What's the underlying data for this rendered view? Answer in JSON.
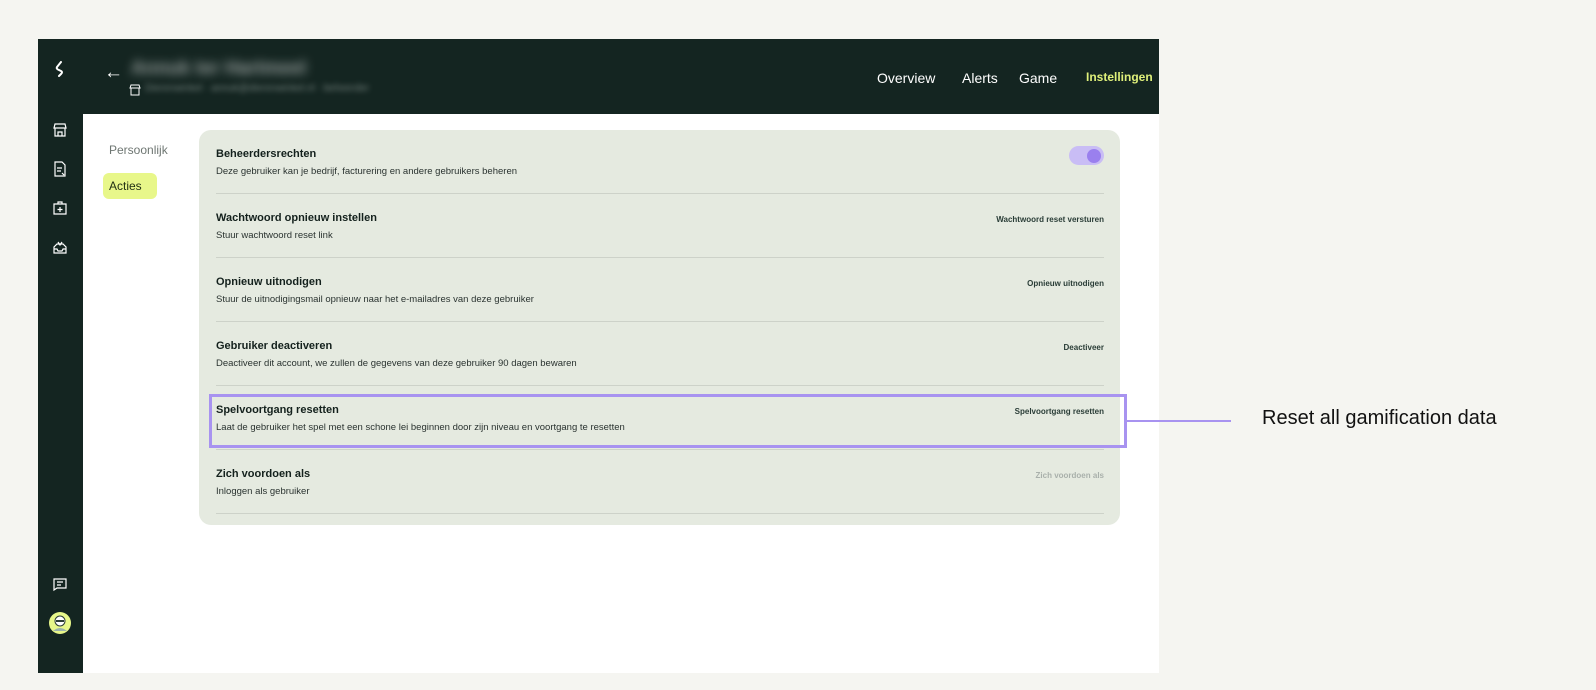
{
  "header": {
    "title_blurred": "Annuk ter Hartmeel",
    "subtitle_blurred": "Dierenwinkel · annuk@dierenwinkel.nl · beheerder",
    "tabs": [
      {
        "label": "Overview",
        "active": false
      },
      {
        "label": "Alerts",
        "active": false
      },
      {
        "label": "Game",
        "active": false
      },
      {
        "label": "Instellingen",
        "active": true
      }
    ]
  },
  "sidebar": {
    "icons": [
      "logo-icon",
      "store-icon",
      "document-icon",
      "medical-case-icon",
      "inbox-icon",
      "chat-icon",
      "avatar"
    ]
  },
  "subnav": {
    "items": [
      {
        "label": "Persoonlijk",
        "active": false
      },
      {
        "label": "Acties",
        "active": true
      }
    ]
  },
  "settings": {
    "rows": [
      {
        "title": "Beheerdersrechten",
        "description": "Deze gebruiker kan je bedrijf, facturering en andere gebruikers beheren",
        "control": "toggle",
        "toggle_on": true
      },
      {
        "title": "Wachtwoord opnieuw instellen",
        "description": "Stuur wachtwoord reset link",
        "action": "Wachtwoord reset versturen"
      },
      {
        "title": "Opnieuw uitnodigen",
        "description": "Stuur de uitnodigingsmail opnieuw naar het e-mailadres van deze gebruiker",
        "action": "Opnieuw uitnodigen"
      },
      {
        "title": "Gebruiker deactiveren",
        "description": "Deactiveer dit account, we zullen de gegevens van deze gebruiker 90 dagen bewaren",
        "action": "Deactiveer"
      },
      {
        "title": "Spelvoortgang resetten",
        "description": "Laat de gebruiker het spel met een schone lei beginnen door zijn niveau en voortgang te resetten",
        "action": "Spelvoortgang resetten"
      },
      {
        "title": "Zich voordoen als",
        "description": "Inloggen als gebruiker",
        "action": "Zich voordoen als",
        "disabled": true
      }
    ]
  },
  "annotation": {
    "text": "Reset all gamification data",
    "color": "#a893f0"
  },
  "colors": {
    "dark": "#142521",
    "accent": "#dff07a",
    "panel": "#e5eae0",
    "toggle": "#9a80ee"
  }
}
